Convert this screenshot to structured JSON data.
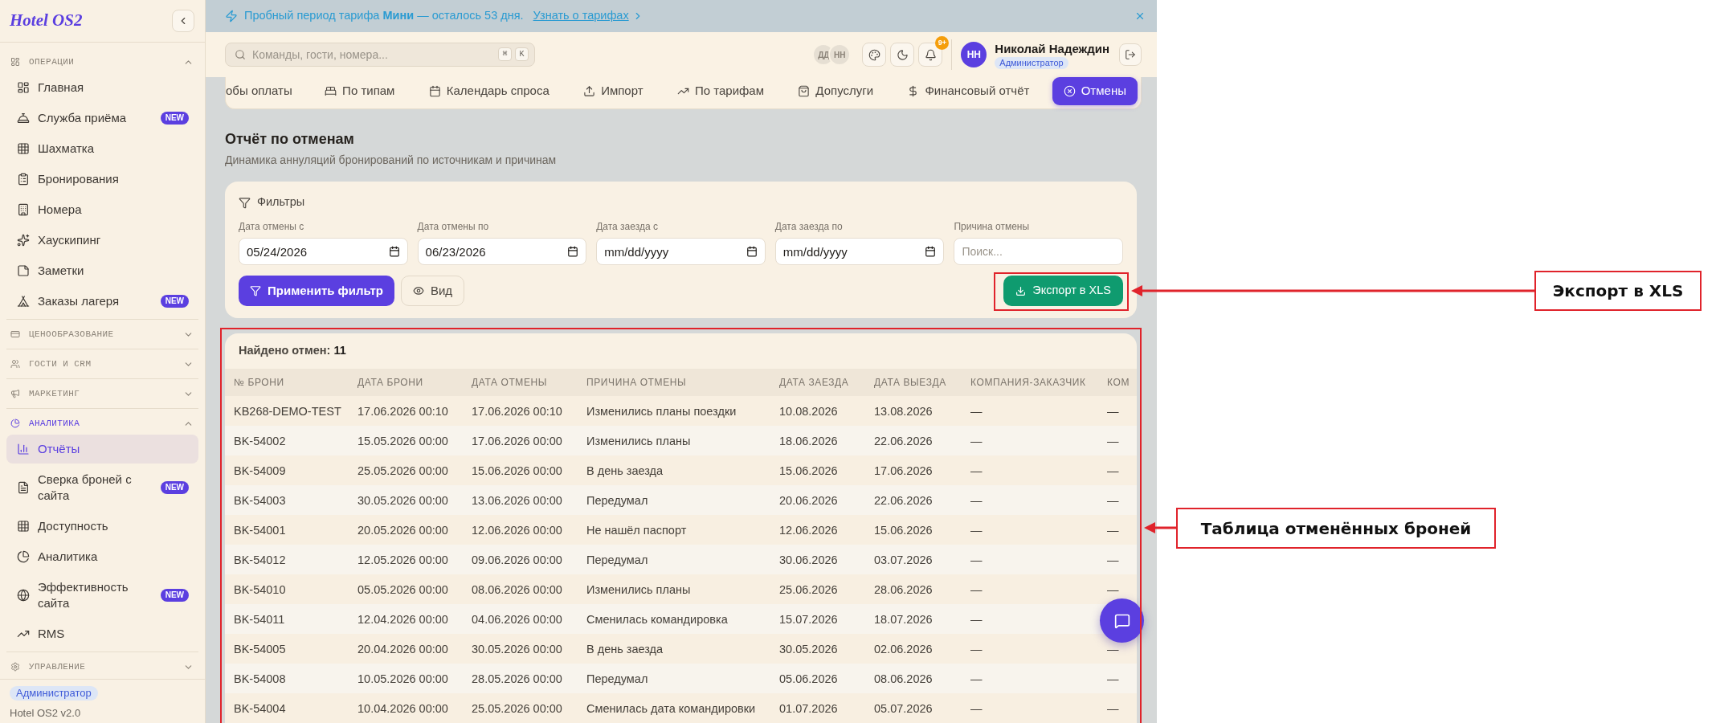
{
  "sidebar": {
    "logo": "Hotel OS2",
    "sections": [
      {
        "title": "ОПЕРАЦИИ",
        "expanded": true,
        "items": [
          {
            "label": "Главная",
            "selected": false
          },
          {
            "label": "Служба приёма",
            "badge": "NEW",
            "selected": false
          },
          {
            "label": "Шахматка",
            "selected": false
          },
          {
            "label": "Бронирования",
            "selected": false
          },
          {
            "label": "Номера",
            "selected": false
          },
          {
            "label": "Хаускипинг",
            "selected": false
          },
          {
            "label": "Заметки",
            "selected": false
          },
          {
            "label": "Заказы лагеря",
            "badge": "NEW",
            "selected": false
          }
        ]
      },
      {
        "title": "ЦЕНООБРАЗОВАНИЕ",
        "expanded": false
      },
      {
        "title": "ГОСТИ И CRM",
        "expanded": false
      },
      {
        "title": "МАРКЕТИНГ",
        "expanded": false
      },
      {
        "title": "АНАЛИТИКА",
        "expanded": true,
        "items": [
          {
            "label": "Отчёты",
            "selected": true
          },
          {
            "label": "Сверка броней с сайта",
            "badge": "NEW",
            "selected": false
          },
          {
            "label": "Доступность",
            "selected": false
          },
          {
            "label": "Аналитика",
            "selected": false
          },
          {
            "label": "Эффективность сайта",
            "badge": "NEW",
            "selected": false
          },
          {
            "label": "RMS",
            "selected": false
          }
        ]
      },
      {
        "title": "УПРАВЛЕНИЕ",
        "expanded": false
      }
    ],
    "footer": {
      "role": "Администратор",
      "version": "Hotel OS2 v2.0"
    }
  },
  "trial_banner": {
    "text": "Пробный период тарифа **Мини** — осталось 53 дня.",
    "link": "Узнать о тарифах"
  },
  "topbar": {
    "search": {
      "placeholder": "Команды, гости, номера...",
      "shortcut": [
        "⌘",
        "K"
      ]
    },
    "online_users": [
      "ДД",
      "НН"
    ],
    "notifications": {
      "badge": "9+"
    },
    "user": {
      "initials": "НН",
      "name": "Николай Надеждин",
      "role": "Администратор"
    }
  },
  "report_tabs": [
    {
      "label": "обы оплаты",
      "selected": false
    },
    {
      "label": "По типам",
      "selected": false
    },
    {
      "label": "Календарь спроса",
      "selected": false
    },
    {
      "label": "Импорт",
      "selected": false
    },
    {
      "label": "По тарифам",
      "selected": false
    },
    {
      "label": "Допуслуги",
      "selected": false
    },
    {
      "label": "Финансовый отчёт",
      "selected": false
    },
    {
      "label": "Отмены",
      "selected": true
    }
  ],
  "page": {
    "title": "Отчёт по отменам",
    "subtitle": "Динамика аннуляций бронирований по источникам и причинам"
  },
  "filters": {
    "title": "Фильтры",
    "fields": [
      {
        "label": "Дата отмены с",
        "kind": "date",
        "value": "05/24/2026"
      },
      {
        "label": "Дата отмены по",
        "kind": "date",
        "value": "06/23/2026"
      },
      {
        "label": "Дата заезда с",
        "kind": "date",
        "placeholder": "mm/dd/yyyy"
      },
      {
        "label": "Дата заезда по",
        "kind": "date",
        "placeholder": "mm/dd/yyyy"
      },
      {
        "label": "Причина отмены",
        "kind": "text",
        "placeholder": "Поиск..."
      }
    ],
    "buttons": [
      {
        "label": "Применить фильтр",
        "kind": "primary"
      },
      {
        "label": "Вид",
        "kind": "secondary"
      },
      {
        "label": "Экспорт в XLS",
        "kind": "export"
      }
    ]
  },
  "table": {
    "summary": "Найдено отмен: **11**",
    "columns": [
      "№ БРОНИ",
      "ДАТА БРОНИ",
      "ДАТА ОТМЕНЫ",
      "ПРИЧИНА ОТМЕНЫ",
      "ДАТА ЗАЕЗДА",
      "ДАТА ВЫЕЗДА",
      "КОМПАНИЯ-ЗАКАЗЧИК",
      "КОМ"
    ],
    "rows": [
      [
        "KB268-DEMO-TEST",
        "17.06.2026 00:10",
        "17.06.2026 00:10",
        "Изменились планы поездки",
        "10.08.2026",
        "13.08.2026",
        "—",
        "—"
      ],
      [
        "BK-54002",
        "15.05.2026 00:00",
        "17.06.2026 00:00",
        "Изменились планы",
        "18.06.2026",
        "22.06.2026",
        "—",
        "—"
      ],
      [
        "BK-54009",
        "25.05.2026 00:00",
        "15.06.2026 00:00",
        "В день заезда",
        "15.06.2026",
        "17.06.2026",
        "—",
        "—"
      ],
      [
        "BK-54003",
        "30.05.2026 00:00",
        "13.06.2026 00:00",
        "Передумал",
        "20.06.2026",
        "22.06.2026",
        "—",
        "—"
      ],
      [
        "BK-54001",
        "20.05.2026 00:00",
        "12.06.2026 00:00",
        "Не нашёл паспорт",
        "12.06.2026",
        "15.06.2026",
        "—",
        "—"
      ],
      [
        "BK-54012",
        "12.05.2026 00:00",
        "09.06.2026 00:00",
        "Передумал",
        "30.06.2026",
        "03.07.2026",
        "—",
        "—"
      ],
      [
        "BK-54010",
        "05.05.2026 00:00",
        "08.06.2026 00:00",
        "Изменились планы",
        "25.06.2026",
        "28.06.2026",
        "—",
        "—"
      ],
      [
        "BK-54011",
        "12.04.2026 00:00",
        "04.06.2026 00:00",
        "Сменилась командировка",
        "15.07.2026",
        "18.07.2026",
        "—"
      ],
      [
        "BK-54005",
        "20.04.2026 00:00",
        "30.05.2026 00:00",
        "В день заезда",
        "30.05.2026",
        "02.06.2026",
        "—",
        "—"
      ],
      [
        "BK-54008",
        "10.05.2026 00:00",
        "28.05.2026 00:00",
        "Передумал",
        "05.06.2026",
        "08.06.2026",
        "—",
        "—"
      ],
      [
        "BK-54004",
        "10.04.2026 00:00",
        "25.05.2026 00:00",
        "Сменилась дата командировки",
        "01.07.2026",
        "05.07.2026",
        "—",
        "—"
      ]
    ]
  },
  "annotations": [
    {
      "label": "Экспорт в XLS",
      "kind": "export"
    },
    {
      "label": "Таблица отменённых броней",
      "kind": "table"
    }
  ]
}
